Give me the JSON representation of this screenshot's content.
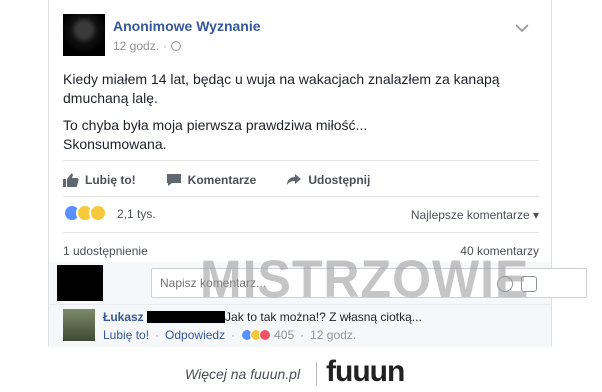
{
  "post": {
    "page_name": "Anonimowe Wyznanie",
    "time": "12 godz.",
    "paragraphs": [
      "Kiedy miałem 14 lat, będąc u wuja na wakacjach znalazłem za kanapą dmuchaną lalę.",
      "To chyba była moja pierwsza prawdziwa miłość...",
      "Skonsumowana."
    ]
  },
  "actions": {
    "like": "Lubię to!",
    "comment": "Komentarze",
    "share": "Udostępnij"
  },
  "reactions": {
    "count": "2,1 tys.",
    "sort": "Najlepsze komentarze"
  },
  "stats": {
    "shares": "1 udostępnienie",
    "comments": "40 komentarzy"
  },
  "comment_box": {
    "placeholder": "Napisz komentarz..."
  },
  "watermark": "MISTRZOWIE",
  "comment": {
    "name": "Łukasz",
    "text": "Jak to tak można!? Z własną ciotką...",
    "like": "Lubię to!",
    "reply": "Odpowiedz",
    "reaction_count": "405",
    "time": "12 godz."
  },
  "footer": {
    "more": "Więcej na fuuun.pl",
    "brand_letters": [
      "f",
      "u",
      "u",
      "u",
      "n"
    ],
    "brand_colors": [
      "#e8412e",
      "#2e9ad6",
      "#7ab648",
      "#f2b21a",
      "#8e44ad"
    ]
  },
  "colors": {
    "link": "#365899",
    "like_blue": "#5890ff"
  }
}
